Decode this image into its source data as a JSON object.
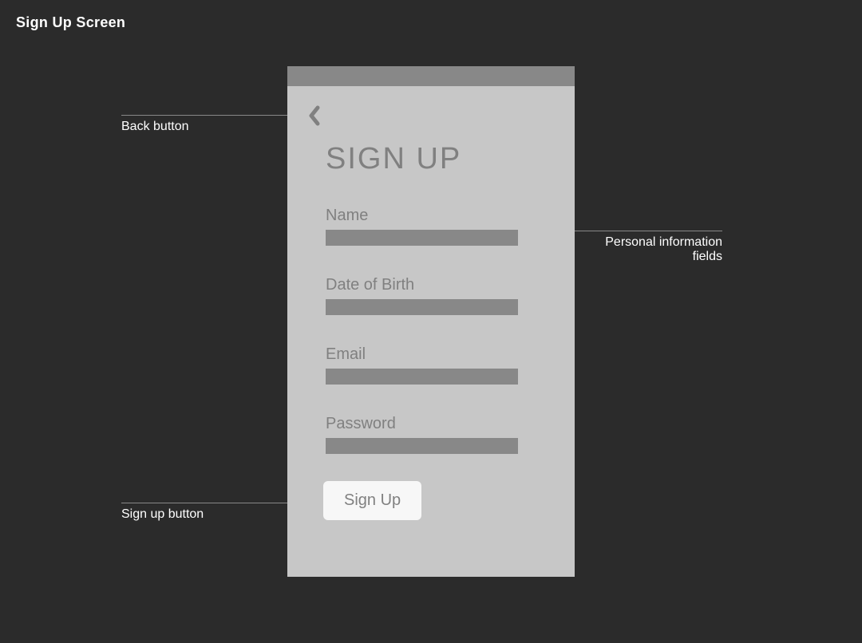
{
  "page_title": "Sign Up Screen",
  "phone": {
    "heading": "SIGN UP",
    "fields": {
      "name_label": "Name",
      "dob_label": "Date of Birth",
      "email_label": "Email",
      "password_label": "Password"
    },
    "signup_button_label": "Sign Up"
  },
  "annotations": {
    "back_button": "Back button",
    "signup_button": "Sign up button",
    "fields_line1": "Personal information",
    "fields_line2": "fields"
  }
}
